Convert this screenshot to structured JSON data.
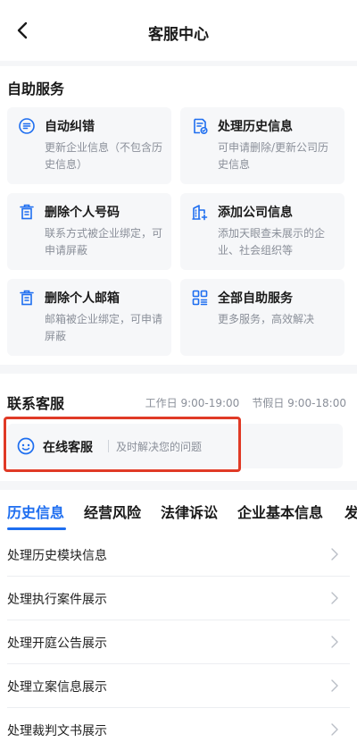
{
  "nav": {
    "title": "客服中心"
  },
  "self_service": {
    "title": "自助服务",
    "cards": [
      {
        "label": "自动纠错",
        "desc": "更新企业信息（不包含历史信息）",
        "icon": "edit-list-icon"
      },
      {
        "label": "处理历史信息",
        "desc": "可申请删除/更新公司历史信息",
        "icon": "history-doc-icon"
      },
      {
        "label": "删除个人号码",
        "desc": "联系方式被企业绑定，可申请屏蔽",
        "icon": "delete-bin-icon"
      },
      {
        "label": "添加公司信息",
        "desc": "添加天眼查未展示的企业、社会组织等",
        "icon": "add-building-icon"
      },
      {
        "label": "删除个人邮箱",
        "desc": "邮箱被企业绑定，可申请屏蔽",
        "icon": "delete-bin-icon"
      },
      {
        "label": "全部自助服务",
        "desc": "更多服务，高效解决",
        "icon": "grid-apps-icon"
      }
    ]
  },
  "contact": {
    "title": "联系客服",
    "workday": "工作日 9:00-19:00",
    "holiday": "节假日 9:00-18:00",
    "online_label": "在线客服",
    "online_hint": "及时解决您的问题"
  },
  "tabs": [
    "历史信息",
    "经营风险",
    "法律诉讼",
    "企业基本信息",
    "发"
  ],
  "active_tab": 0,
  "faq": [
    "处理历史模块信息",
    "处理执行案件展示",
    "处理开庭公告展示",
    "处理立案信息展示",
    "处理裁判文书展示"
  ],
  "colors": {
    "accent": "#1e6ef0",
    "highlight": "#e03a26"
  }
}
